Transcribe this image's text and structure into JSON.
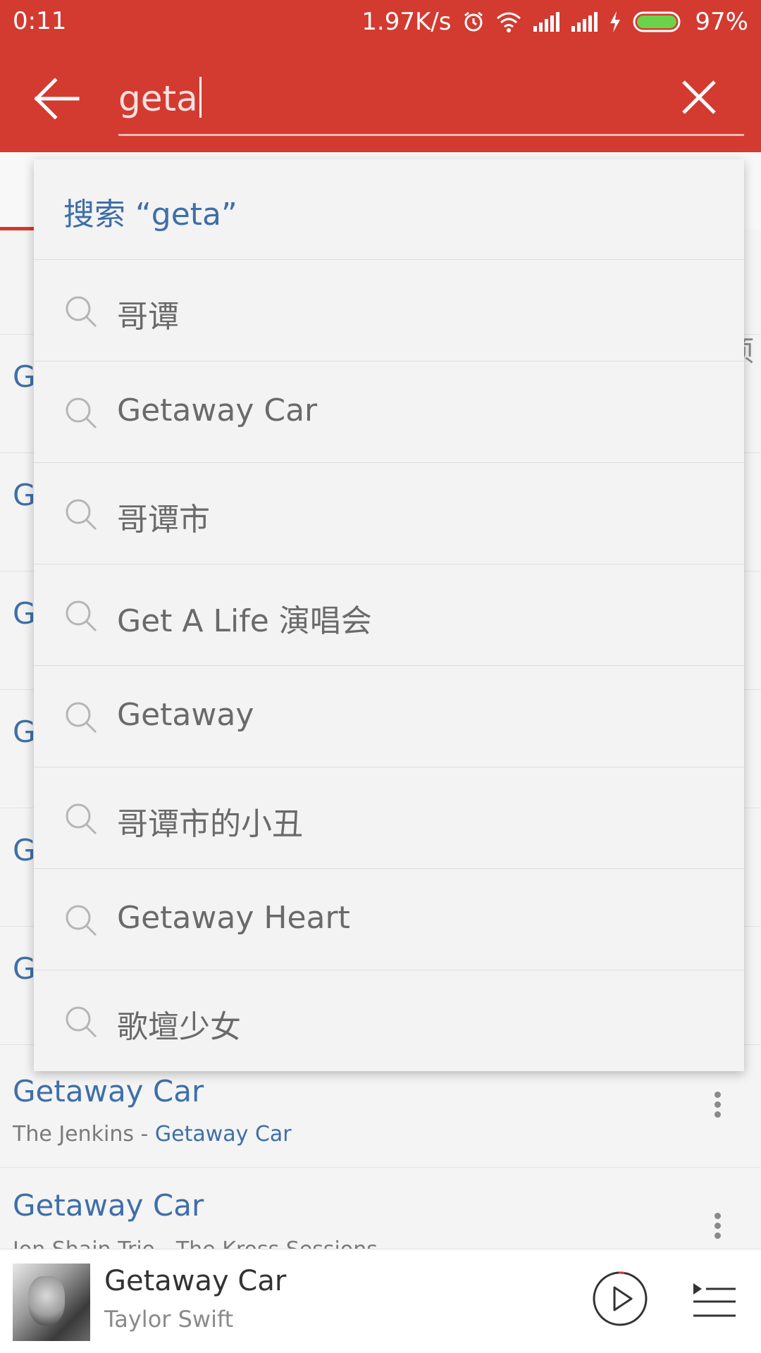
{
  "status_bar": {
    "time": "0:11",
    "net_speed": "1.97K/s",
    "battery": "97%",
    "icons": [
      "alarm-icon",
      "wifi-icon",
      "signal-icon",
      "signal-icon",
      "charging-icon",
      "battery-icon"
    ]
  },
  "search": {
    "query": "geta"
  },
  "background": {
    "tab_peek": "项",
    "rows": [
      {
        "title": "Getaway Car",
        "sub_prefix": "The Jenkins - ",
        "sub_highlight": "Getaway Car"
      },
      {
        "title": "Getaway Car",
        "sub_prefix": "Jon Shain Trio - The Kross Sessions",
        "sub_highlight": ""
      }
    ]
  },
  "dropdown": {
    "header": "搜索 “geta”",
    "suggestions": [
      "哥谭",
      "Getaway Car",
      "哥谭市",
      "Get A Life 演唱会",
      "Getaway",
      "哥谭市的小丑",
      "Getaway Heart",
      "歌壇少女"
    ]
  },
  "player": {
    "title": "Getaway Car",
    "artist": "Taylor Swift"
  },
  "colors": {
    "header_red": "#d33a30",
    "link_blue": "#3f6fa8"
  }
}
